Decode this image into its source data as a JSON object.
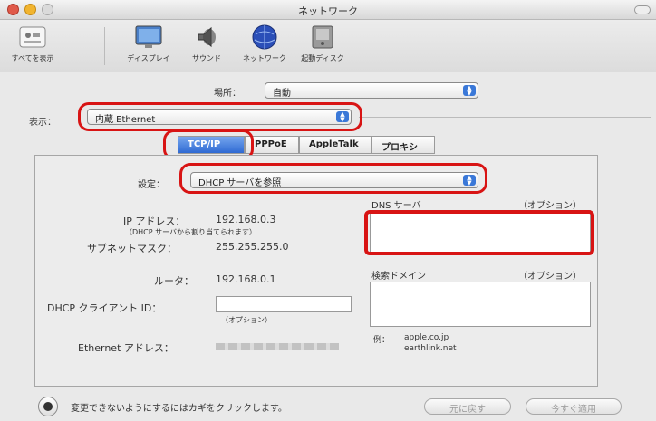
{
  "window": {
    "title": "ネットワーク"
  },
  "toolbar": {
    "items": [
      {
        "label": "すべてを表示",
        "icon": "show-all-icon"
      },
      {
        "label": "ディスプレイ",
        "icon": "display-icon"
      },
      {
        "label": "サウンド",
        "icon": "sound-icon"
      },
      {
        "label": "ネットワーク",
        "icon": "network-icon"
      },
      {
        "label": "起動ディスク",
        "icon": "startup-disk-icon"
      }
    ]
  },
  "location": {
    "label": "場所：",
    "value": "自動"
  },
  "show": {
    "label": "表示：",
    "value": "内蔵 Ethernet"
  },
  "tabs": [
    "TCP/IP",
    "PPPoE",
    "AppleTalk",
    "プロキシ"
  ],
  "config": {
    "label": "設定：",
    "value": "DHCP サーバを参照"
  },
  "dns": {
    "label": "DNS サーバ",
    "optional": "（オプション）"
  },
  "search_domains": {
    "label": "検索ドメイン",
    "optional": "（オプション）"
  },
  "ip": {
    "label": "IP アドレス：",
    "value": "192.168.0.3",
    "note": "（DHCP サーバから割り当てられます）"
  },
  "subnet": {
    "label": "サブネットマスク：",
    "value": "255.255.255.0"
  },
  "router": {
    "label": "ルータ：",
    "value": "192.168.0.1"
  },
  "dhcp_client": {
    "label": "DHCP クライアント ID：",
    "optional": "（オプション）"
  },
  "ethernet": {
    "label": "Ethernet アドレス："
  },
  "example": {
    "prefix": "例：",
    "line1": "apple.co.jp",
    "line2": "earthlink.net"
  },
  "footer": {
    "lock_text": "変更できないようにするにはカギをクリックします。",
    "revert": "元に戻す",
    "apply": "今すぐ適用"
  }
}
